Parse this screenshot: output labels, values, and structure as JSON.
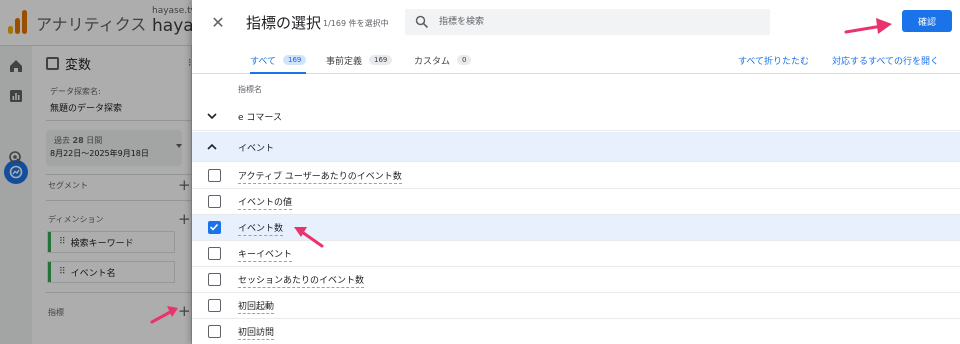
{
  "app": {
    "title": "アナリティクス",
    "account_small": "hayase.tv G",
    "account_big": "hayas"
  },
  "variables_panel": {
    "title": "変数",
    "exploration_label": "データ探索名:",
    "exploration_name": "無題のデータ探索",
    "date_range_prefix": "過去",
    "date_range_days": "28",
    "date_range_suffix": "日間",
    "date_range_value": "8月22日～2025年9月18日",
    "segments_label": "セグメント",
    "dimensions_label": "ディメンション",
    "dimensions": [
      "検索キーワード",
      "イベント名"
    ],
    "metrics_label": "指標"
  },
  "dialog": {
    "title": "指標の選択",
    "count": "1/169 件を選択中",
    "search_placeholder": "指標を検索",
    "confirm_label": "確認",
    "tabs": [
      {
        "label": "すべて",
        "count": "169",
        "active": true
      },
      {
        "label": "事前定義",
        "count": "169",
        "active": false
      },
      {
        "label": "カスタム",
        "count": "0",
        "active": false
      }
    ],
    "collapse_all": "すべて折りたたむ",
    "expand_all": "対応するすべての行を開く",
    "column_header": "指標名",
    "groups": [
      {
        "label": "e コマース",
        "expanded": false
      },
      {
        "label": "イベント",
        "expanded": true
      }
    ],
    "metrics": [
      {
        "label": "アクティブ ユーザーあたりのイベント数",
        "checked": false
      },
      {
        "label": "イベントの値",
        "checked": false
      },
      {
        "label": "イベント数",
        "checked": true
      },
      {
        "label": "キーイベント",
        "checked": false
      },
      {
        "label": "セッションあたりのイベント数",
        "checked": false
      },
      {
        "label": "初回起動",
        "checked": false
      },
      {
        "label": "初回訪問",
        "checked": false
      }
    ]
  },
  "colors": {
    "accent": "#1a73e8",
    "annotation_arrow": "#e8336d",
    "selected_row": "#e8f0fe"
  }
}
